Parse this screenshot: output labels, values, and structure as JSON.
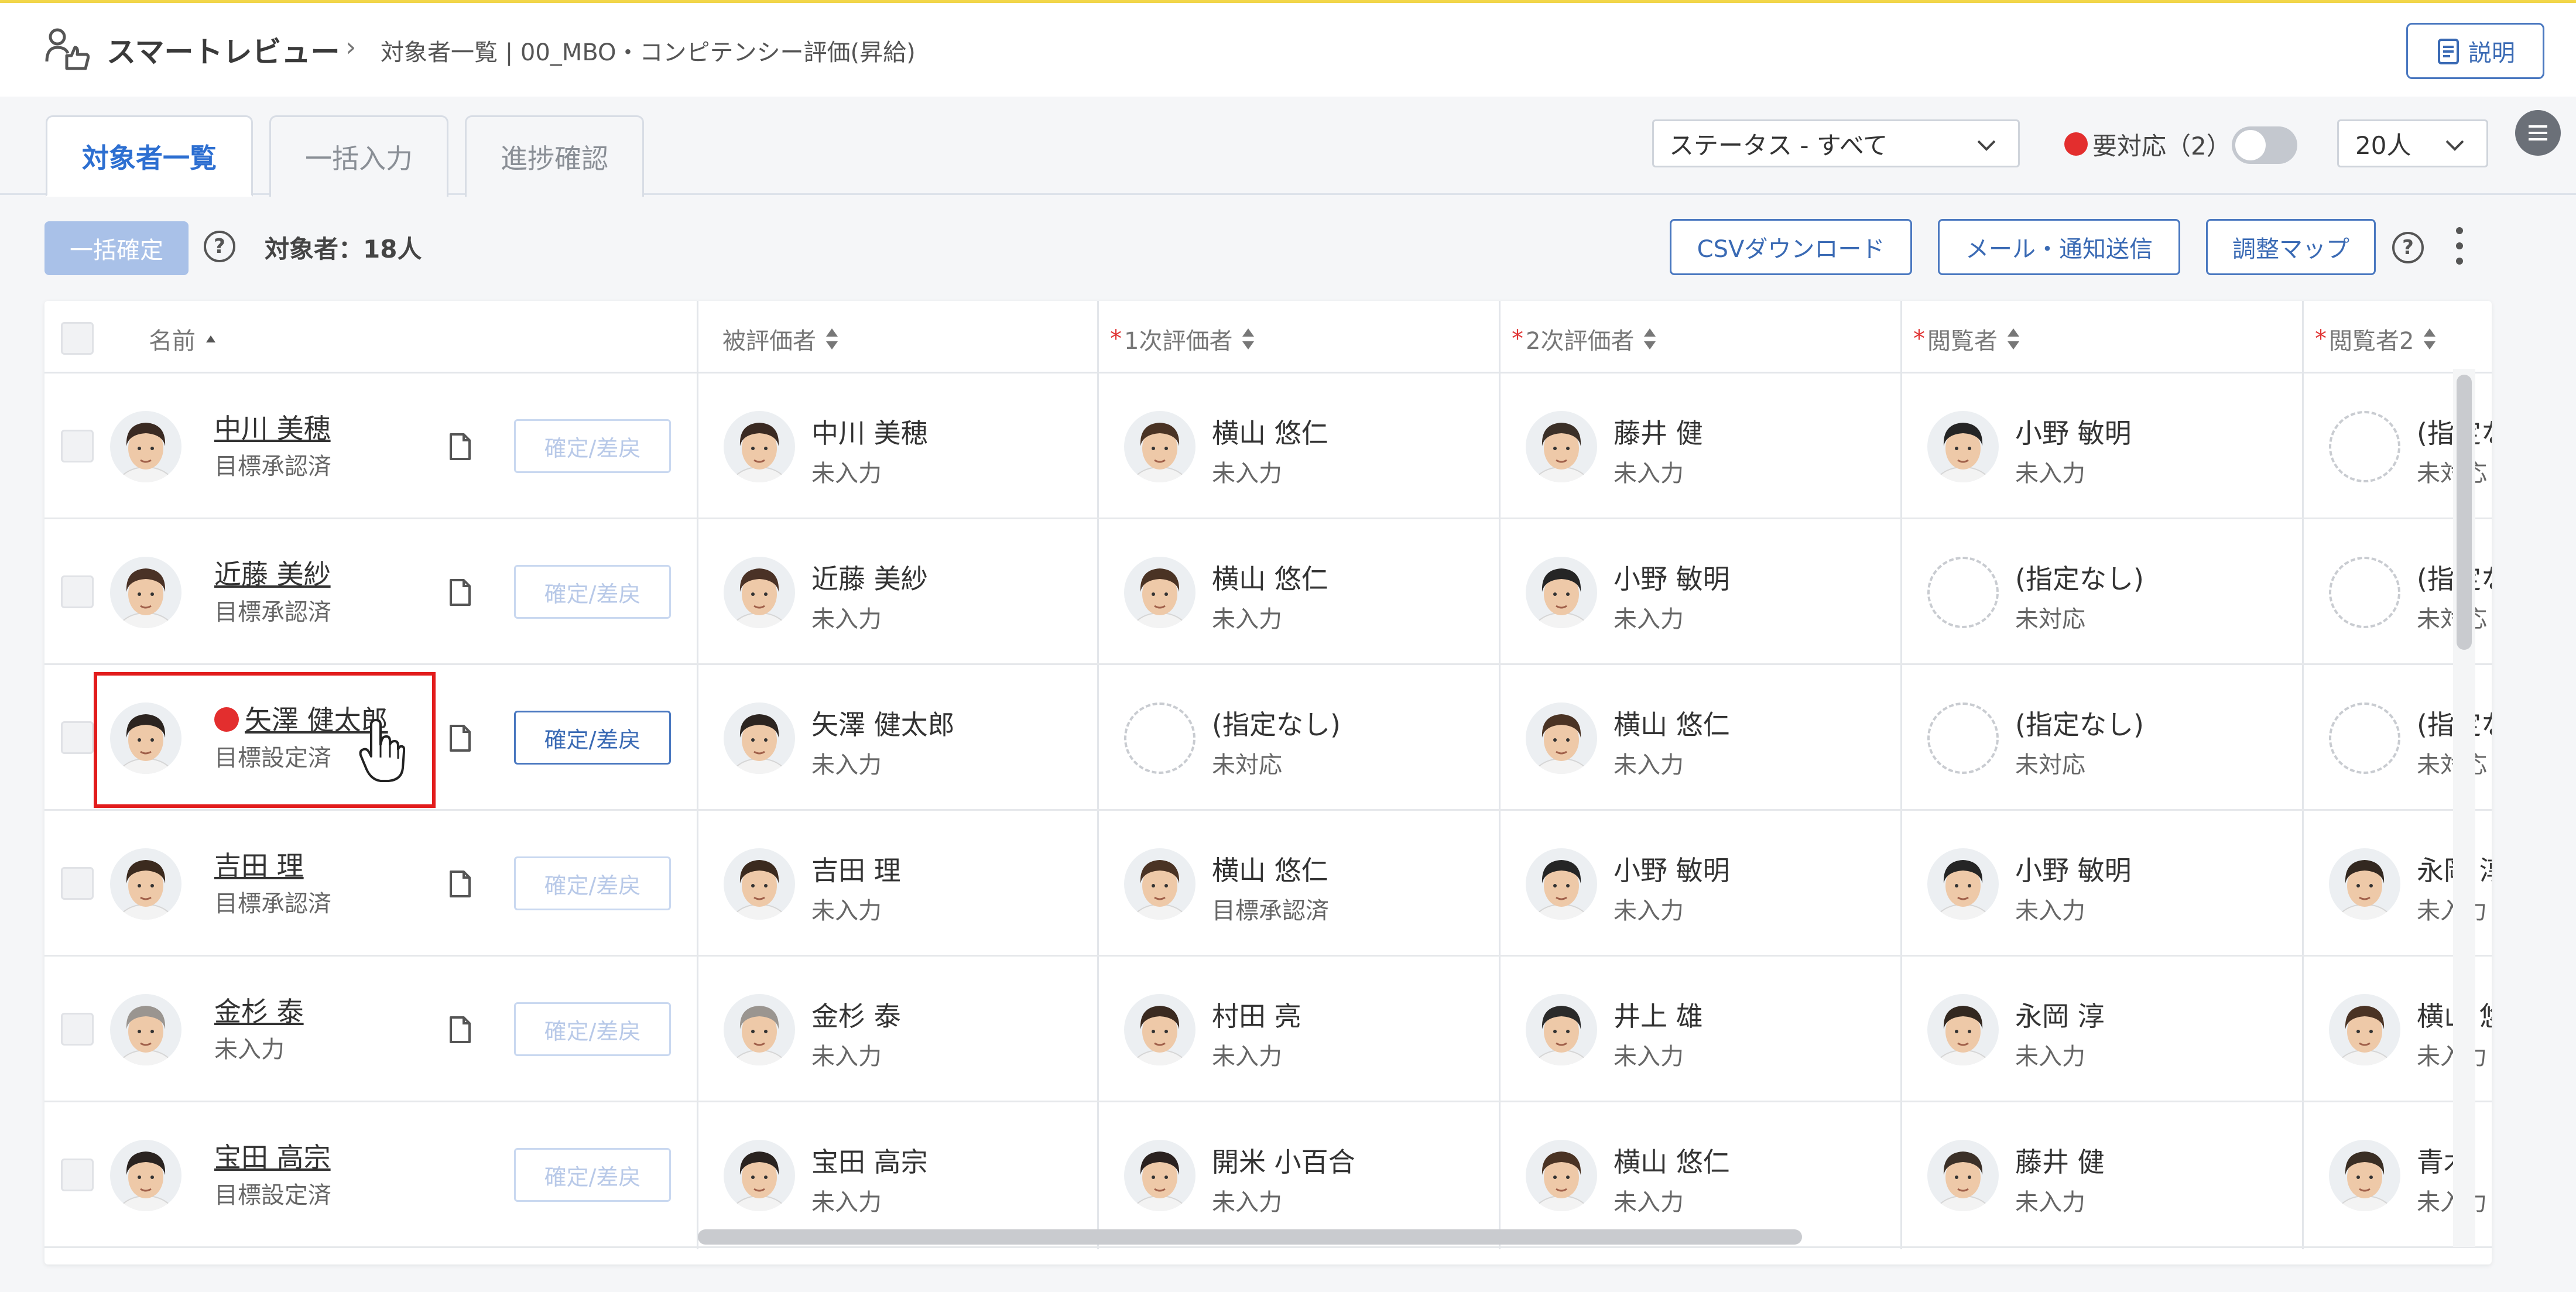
{
  "app": {
    "title": "スマートレビュー",
    "breadcrumb": "対象者一覧 | 00_MBO・コンピテンシー評価(昇給)",
    "help_label": "説明"
  },
  "tabs": [
    {
      "label": "対象者一覧",
      "active": true
    },
    {
      "label": "一括入力",
      "active": false
    },
    {
      "label": "進捗確認",
      "active": false
    }
  ],
  "filters": {
    "status_select": "ステータス - すべて",
    "need_action_label": "要対応（2）",
    "need_action_toggle": false,
    "page_size": "20人"
  },
  "toolbar": {
    "bulk_confirm": "一括確定",
    "target_count": "対象者：18人",
    "csv_download": "CSVダウンロード",
    "mail_send": "メール・通知送信",
    "adjust_map": "調整マップ"
  },
  "columns": {
    "name": "名前",
    "evaluatee": "被評価者",
    "first_evaluator": "1次評価者",
    "second_evaluator": "2次評価者",
    "viewer": "閲覧者",
    "viewer2": "閲覧者2",
    "required_mark": "*"
  },
  "confirm_label": "確定/差戻",
  "rows": [
    {
      "name": "中川 美穂",
      "status": "目標承認済",
      "alert": false,
      "confirm_enabled": false,
      "has_doc": true,
      "evaluatee": {
        "name": "中川 美穂",
        "status": "未入力"
      },
      "first": {
        "name": "横山 悠仁",
        "status": "未入力"
      },
      "second": {
        "name": "藤井 健",
        "status": "未入力"
      },
      "viewer": {
        "name": "小野 敏明",
        "status": "未入力"
      },
      "viewer2": {
        "name": "(指定なし)",
        "status": "未対応"
      }
    },
    {
      "name": "近藤 美紗",
      "status": "目標承認済",
      "alert": false,
      "confirm_enabled": false,
      "has_doc": true,
      "evaluatee": {
        "name": "近藤 美紗",
        "status": "未入力"
      },
      "first": {
        "name": "横山 悠仁",
        "status": "未入力"
      },
      "second": {
        "name": "小野 敏明",
        "status": "未入力"
      },
      "viewer": {
        "name": "(指定なし)",
        "status": "未対応"
      },
      "viewer2": {
        "name": "(指定なし)",
        "status": "未対応"
      }
    },
    {
      "name": "矢澤 健太郎",
      "status": "目標設定済",
      "alert": true,
      "confirm_enabled": true,
      "has_doc": true,
      "evaluatee": {
        "name": "矢澤 健太郎",
        "status": "未入力"
      },
      "first": {
        "name": "(指定なし)",
        "status": "未対応"
      },
      "second": {
        "name": "横山 悠仁",
        "status": "未入力"
      },
      "viewer": {
        "name": "(指定なし)",
        "status": "未対応"
      },
      "viewer2": {
        "name": "(指定なし)",
        "status": "未対応"
      }
    },
    {
      "name": "吉田 理",
      "status": "目標承認済",
      "alert": false,
      "confirm_enabled": false,
      "has_doc": true,
      "evaluatee": {
        "name": "吉田 理",
        "status": "未入力"
      },
      "first": {
        "name": "横山 悠仁",
        "status": "目標承認済"
      },
      "second": {
        "name": "小野 敏明",
        "status": "未入力"
      },
      "viewer": {
        "name": "小野 敏明",
        "status": "未入力"
      },
      "viewer2": {
        "name": "永岡 淳",
        "status": "未入力"
      }
    },
    {
      "name": "金杉 泰",
      "status": "未入力",
      "alert": false,
      "confirm_enabled": false,
      "has_doc": true,
      "evaluatee": {
        "name": "金杉 泰",
        "status": "未入力"
      },
      "first": {
        "name": "村田 亮",
        "status": "未入力"
      },
      "second": {
        "name": "井上 雄",
        "status": "未入力"
      },
      "viewer": {
        "name": "永岡 淳",
        "status": "未入力"
      },
      "viewer2": {
        "name": "横山 悠仁",
        "status": "未入力"
      }
    },
    {
      "name": "宝田 高宗",
      "status": "目標設定済",
      "alert": false,
      "confirm_enabled": false,
      "has_doc": false,
      "evaluatee": {
        "name": "宝田 高宗",
        "status": "未入力"
      },
      "first": {
        "name": "開米 小百合",
        "status": "未入力"
      },
      "second": {
        "name": "横山 悠仁",
        "status": "未入力"
      },
      "viewer": {
        "name": "藤井 健",
        "status": "未入力"
      },
      "viewer2": {
        "name": "青木",
        "status": "未入力"
      }
    }
  ],
  "colors": {
    "accent": "#3a6ab4",
    "alert": "#e32e2e",
    "highlight": "#e21c1c",
    "top_bar": "#f3d74a"
  },
  "avatar_tones": {
    "中川 美穂": "#3a2a22",
    "近藤 美紗": "#4a3226",
    "矢澤 健太郎": "#2c2420",
    "吉田 理": "#3b2a1e",
    "金杉 泰": "#9a9590",
    "宝田 高宗": "#2a2320",
    "横山 悠仁": "#4a3324",
    "藤井 健": "#3b3028",
    "小野 敏明": "#252525",
    "村田 亮": "#3a2a20",
    "井上 雄": "#2a2a2a",
    "永岡 淳": "#332820",
    "開米 小百合": "#2b2220",
    "青木": "#3a2e24"
  }
}
